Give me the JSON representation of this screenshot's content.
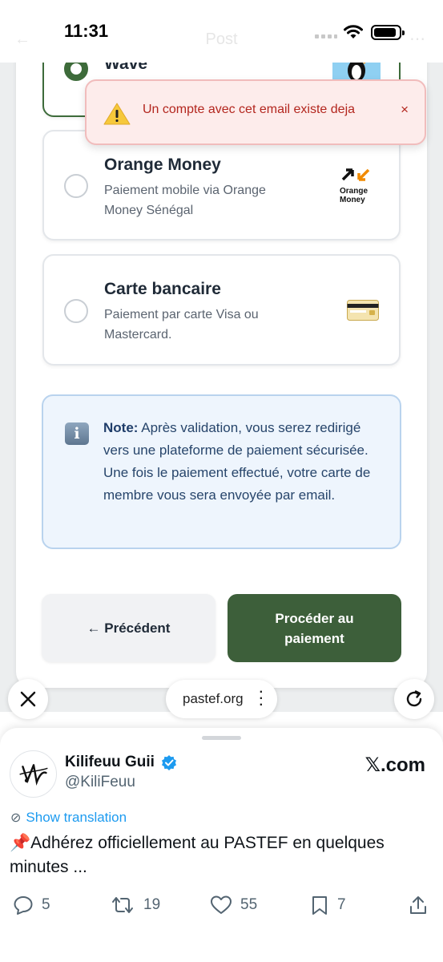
{
  "status_bar": {
    "time": "11:31",
    "ghost_title": "Post",
    "icons": [
      "signal-icon",
      "wifi-icon",
      "battery-icon"
    ]
  },
  "toast": {
    "icon": "warning-icon",
    "message": "Un compte avec cet email existe deja",
    "close": "×"
  },
  "payment_options": [
    {
      "name": "Wave",
      "selected": true
    },
    {
      "name": "Orange Money",
      "description": "Paiement mobile via Orange Money Sénégal",
      "logo_text": "Orange Money",
      "selected": false
    },
    {
      "name": "Carte bancaire",
      "description": "Paiement par carte Visa ou Mastercard.",
      "selected": false
    }
  ],
  "note": {
    "label": "Note:",
    "text": "Après validation, vous serez redirigé vers une plateforme de paiement sécurisée. Une fois le paiement effectué, votre carte de membre vous sera envoyée par email."
  },
  "buttons": {
    "previous": "← Précédent",
    "proceed": "Procéder au paiement"
  },
  "browser": {
    "url": "pastef.org",
    "close_icon": "close-icon",
    "reload_icon": "reload-icon"
  },
  "tweet": {
    "author": "Kilifeuu Guii",
    "handle": "@KiliFeuu",
    "source": "𝕏.com",
    "show_translation": "Show translation",
    "text": "📌Adhérez officiellement au PASTEF en quelques minutes ...",
    "replies": "5",
    "reposts": "19",
    "likes": "55",
    "bookmarks": "7"
  },
  "colors": {
    "brand_green": "#3d6b3a",
    "button_green": "#3d5f3a",
    "error_red": "#b3261e",
    "link_blue": "#1d9bf0"
  }
}
